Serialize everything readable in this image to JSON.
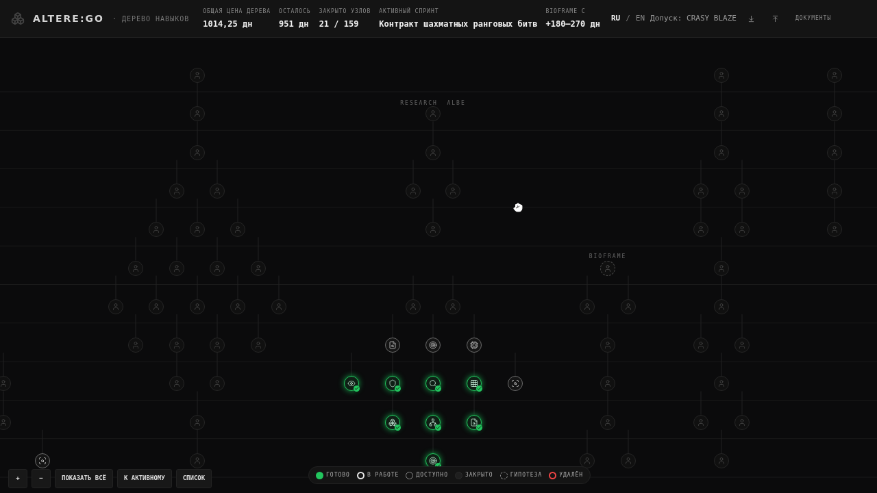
{
  "header": {
    "brand": "ALTERE:GO",
    "subtitle": "· ДЕРЕВО НАВЫКОВ",
    "stats": [
      {
        "label": "ОБЩАЯ ЦЕНА ДЕРЕВА",
        "value": "1014,25 дн"
      },
      {
        "label": "ОСТАЛОСЬ",
        "value": "951 дн"
      },
      {
        "label": "ЗАКРЫТО УЗЛОВ",
        "value": "21 / 159"
      },
      {
        "label": "АКТИВНЫЙ СПРИНТ",
        "value": "Контракт шахматных ранговых битв"
      },
      {
        "label": "BIOFRAME C",
        "value": "+180–270 дн"
      }
    ],
    "languages": [
      {
        "label": "RU",
        "selected": true
      },
      {
        "label": "EN",
        "selected": false
      }
    ],
    "separator": "/",
    "access": "Допуск: CRASY BLAZE",
    "docs": "ДОКУМЕНТЫ"
  },
  "clusters": [
    {
      "nodes": [
        {
          "kind": "closed"
        },
        {
          "kind": "closed"
        },
        {
          "kind": "closed"
        },
        {
          "kind": "closed"
        },
        {
          "kind": "closed"
        },
        {
          "kind": "closed"
        },
        {
          "kind": "closed"
        },
        {
          "kind": "closed"
        },
        {
          "kind": "closed"
        },
        {
          "kind": "closed"
        },
        {
          "kind": "closed"
        },
        {
          "kind": "closed"
        },
        {
          "kind": "closed"
        },
        {
          "kind": "closed"
        },
        {
          "kind": "closed"
        },
        {
          "kind": "closed"
        },
        {
          "kind": "closed"
        },
        {
          "kind": "closed"
        },
        {
          "kind": "closed"
        },
        {
          "kind": "closed"
        },
        {
          "kind": "closed"
        },
        {
          "kind": "closed"
        },
        {
          "kind": "closed"
        },
        {
          "kind": "closed"
        },
        {
          "kind": "closed"
        },
        {
          "kind": "available"
        },
        {
          "kind": "closed"
        },
        {
          "kind": "closed"
        }
      ]
    },
    {
      "label": "RESEARCH  ALBE",
      "nodes": [
        {
          "kind": "closed"
        },
        {
          "kind": "closed"
        },
        {
          "kind": "closed"
        },
        {
          "kind": "closed"
        },
        {
          "kind": "closed"
        },
        {
          "kind": "closed"
        },
        {
          "kind": "closed"
        },
        {
          "kind": "available"
        },
        {
          "kind": "available"
        },
        {
          "kind": "available"
        },
        {
          "kind": "done"
        },
        {
          "kind": "done"
        },
        {
          "kind": "done"
        },
        {
          "kind": "done"
        },
        {
          "kind": "available"
        },
        {
          "kind": "done"
        },
        {
          "kind": "done"
        },
        {
          "kind": "done"
        },
        {
          "kind": "done"
        }
      ]
    },
    {
      "label": "BIOFRAME",
      "nodes": [
        {
          "kind": "hypothesis"
        },
        {
          "kind": "closed"
        },
        {
          "kind": "closed"
        },
        {
          "kind": "closed"
        },
        {
          "kind": "closed"
        },
        {
          "kind": "closed"
        },
        {
          "kind": "closed"
        },
        {
          "kind": "closed"
        }
      ]
    },
    {
      "nodes": [
        {
          "kind": "closed"
        },
        {
          "kind": "closed"
        },
        {
          "kind": "closed"
        },
        {
          "kind": "closed"
        },
        {
          "kind": "closed"
        },
        {
          "kind": "closed"
        },
        {
          "kind": "closed"
        },
        {
          "kind": "closed"
        },
        {
          "kind": "closed"
        },
        {
          "kind": "closed"
        },
        {
          "kind": "closed"
        },
        {
          "kind": "closed"
        },
        {
          "kind": "closed"
        },
        {
          "kind": "closed"
        },
        {
          "kind": "closed"
        },
        {
          "kind": "closed"
        },
        {
          "kind": "closed"
        },
        {
          "kind": "closed"
        },
        {
          "kind": "closed"
        },
        {
          "kind": "closed"
        }
      ]
    }
  ],
  "controls": [
    "+",
    "−",
    "ПОКАЗАТЬ ВСЁ",
    "К АКТИВНОМУ",
    "СПИСОК"
  ],
  "legend": [
    {
      "kind": "done",
      "label": "ГОТОВО"
    },
    {
      "kind": "progress",
      "label": "В РАБОТЕ"
    },
    {
      "kind": "available",
      "label": "ДОСТУПНО"
    },
    {
      "kind": "closed",
      "label": "ЗАКРЫТО"
    },
    {
      "kind": "hypothesis",
      "label": "ГИПОТЕЗА"
    },
    {
      "kind": "removed",
      "label": "УДАЛЁН"
    }
  ]
}
